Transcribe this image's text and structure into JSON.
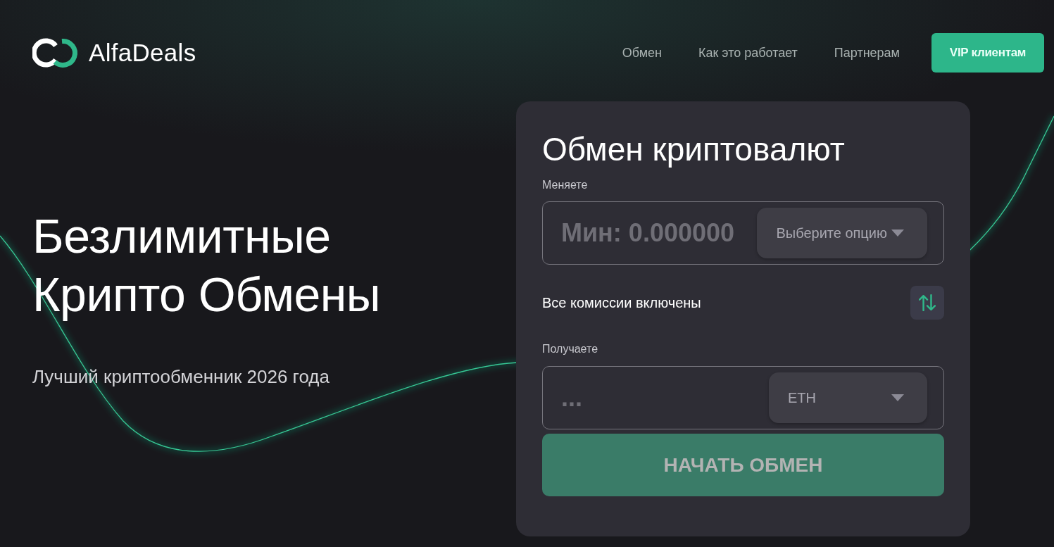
{
  "header": {
    "logo": {
      "name": "AlfaDeals"
    },
    "nav": [
      {
        "label": "Обмен"
      },
      {
        "label": "Как это работает"
      },
      {
        "label": "Партнерам"
      }
    ],
    "vip_button": "VIP клиентам"
  },
  "hero": {
    "title": "Безлимитные Крипто Обмены",
    "subtitle": "Лучший криптообменник 2026 года"
  },
  "exchange_card": {
    "title": "Обмен криптовалют",
    "send": {
      "label": "Меняете",
      "placeholder": "Мин: 0.000000",
      "select": "Выберите опцию"
    },
    "fees_note": "Все комиссии включены",
    "receive": {
      "label": "Получаете",
      "placeholder": "...",
      "select": "ETH"
    },
    "submit": {
      "label": "НАЧАТЬ ОБМЕН",
      "disabled": true
    }
  }
}
